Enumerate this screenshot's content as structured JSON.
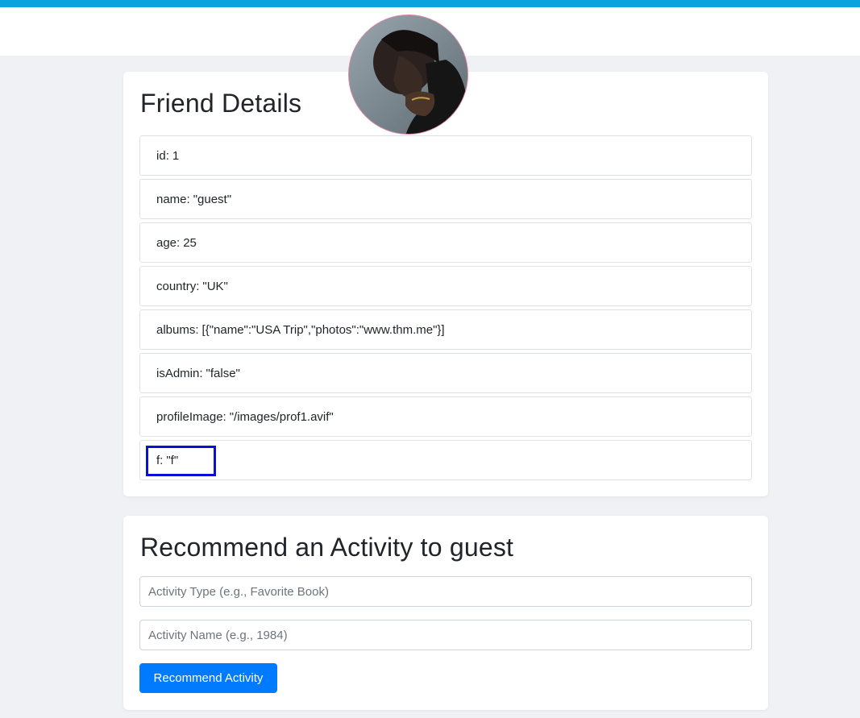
{
  "friend_details": {
    "title": "Friend Details",
    "fields": [
      {
        "key": "id",
        "value": "1"
      },
      {
        "key": "name",
        "value": "\"guest\""
      },
      {
        "key": "age",
        "value": "25"
      },
      {
        "key": "country",
        "value": "\"UK\""
      },
      {
        "key": "albums",
        "value": "[{\"name\":\"USA Trip\",\"photos\":\"www.thm.me\"}]"
      },
      {
        "key": "isAdmin",
        "value": "\"false\""
      },
      {
        "key": "profileImage",
        "value": "\"/images/prof1.avif\""
      },
      {
        "key": "f",
        "value": "\"f\""
      }
    ],
    "separator": ":"
  },
  "recommend": {
    "title": "Recommend an Activity to guest",
    "activity_type_placeholder": "Activity Type (e.g., Favorite Book)",
    "activity_name_placeholder": "Activity Name (e.g., 1984)",
    "submit_label": "Recommend Activity"
  },
  "colors": {
    "top_stripe": "#0aa3dd",
    "page_background": "#f0f1f5",
    "primary_button": "#007bff",
    "highlight_box": "#0a10d6",
    "avatar_border": "#e48aa6"
  }
}
